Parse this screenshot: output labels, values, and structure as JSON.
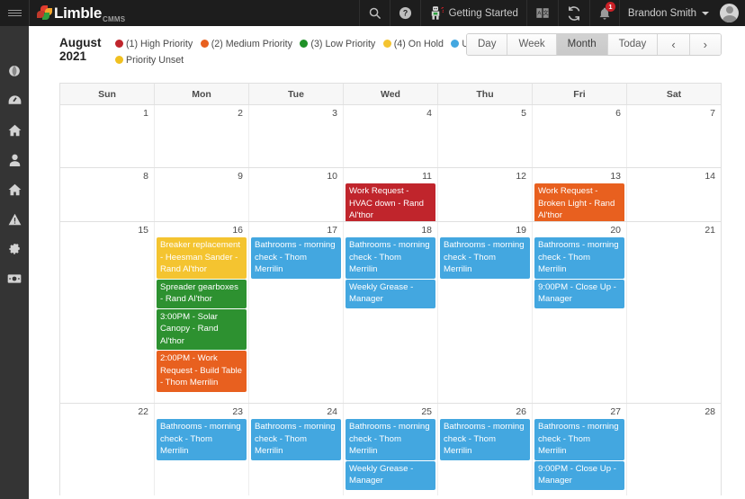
{
  "topbar": {
    "hamburger": "menu-icon",
    "logo_text": "Limble",
    "logo_sub": "CMMS",
    "getting_started": "Getting Started",
    "notification_count": "1",
    "user_name": "Brandon Smith"
  },
  "sidebar": {
    "items": [
      {
        "icon": "globe-icon",
        "name": "sidebar-item-globe"
      },
      {
        "icon": "dashboard-icon",
        "name": "sidebar-item-dashboard"
      },
      {
        "icon": "home-icon",
        "name": "sidebar-item-home"
      },
      {
        "icon": "user-icon",
        "name": "sidebar-item-user"
      },
      {
        "icon": "assets-icon",
        "name": "sidebar-item-assets"
      },
      {
        "icon": "warning-icon",
        "name": "sidebar-item-warning"
      },
      {
        "icon": "gear-icon",
        "name": "sidebar-item-settings"
      },
      {
        "icon": "money-icon",
        "name": "sidebar-item-billing"
      }
    ]
  },
  "calendar": {
    "month": "August",
    "year": "2021",
    "legend": [
      {
        "label": "(1) High Priority",
        "color": "#c0252c"
      },
      {
        "label": "(2) Medium Priority",
        "color": "#e8601f"
      },
      {
        "label": "(3) Low Priority",
        "color": "#1f9127"
      },
      {
        "label": "(4) On Hold",
        "color": "#f4c430"
      },
      {
        "label": "Upcoming",
        "color": "#43a7e0"
      },
      {
        "label": "Priority Unset",
        "color": "#f0c020"
      }
    ],
    "views": [
      {
        "label": "Day",
        "active": false
      },
      {
        "label": "Week",
        "active": false
      },
      {
        "label": "Month",
        "active": true
      },
      {
        "label": "Today",
        "active": false
      },
      {
        "label": "‹",
        "active": false
      },
      {
        "label": "›",
        "active": false
      }
    ],
    "day_headers": [
      "Sun",
      "Mon",
      "Tue",
      "Wed",
      "Thu",
      "Fri",
      "Sat"
    ],
    "weeks": [
      {
        "row": "wk-r1",
        "days": [
          {
            "num": "1",
            "events": []
          },
          {
            "num": "2",
            "events": []
          },
          {
            "num": "3",
            "events": []
          },
          {
            "num": "4",
            "events": []
          },
          {
            "num": "5",
            "events": []
          },
          {
            "num": "6",
            "events": []
          },
          {
            "num": "7",
            "events": []
          }
        ]
      },
      {
        "row": "wk-r2",
        "days": [
          {
            "num": "8",
            "events": []
          },
          {
            "num": "9",
            "events": []
          },
          {
            "num": "10",
            "events": []
          },
          {
            "num": "11",
            "events": [
              {
                "title": "Work Request - HVAC down - Rand Al'thor",
                "color": "#c0252c"
              }
            ]
          },
          {
            "num": "12",
            "events": []
          },
          {
            "num": "13",
            "events": [
              {
                "title": "Work Request - Broken Light - Rand Al'thor",
                "color": "#e8601f"
              }
            ]
          },
          {
            "num": "14",
            "events": []
          }
        ]
      },
      {
        "row": "wk-r3",
        "days": [
          {
            "num": "15",
            "events": []
          },
          {
            "num": "16",
            "events": [
              {
                "title": "Breaker replacement - Heesman Sander - Rand Al'thor",
                "color": "#f4c430"
              },
              {
                "title": "Spreader gearboxes - Rand Al'thor",
                "color": "#2d9130"
              },
              {
                "title": "3:00PM - Solar Canopy - Rand Al'thor",
                "color": "#2d9130"
              },
              {
                "title": "2:00PM - Work Request - Build Table - Thom Merrilin",
                "color": "#e8601f"
              }
            ]
          },
          {
            "num": "17",
            "events": [
              {
                "title": "Bathrooms - morning check - Thom Merrilin",
                "color": "#43a7e0"
              }
            ]
          },
          {
            "num": "18",
            "events": [
              {
                "title": "Bathrooms - morning check - Thom Merrilin",
                "color": "#43a7e0"
              },
              {
                "title": "Weekly Grease - Manager",
                "color": "#43a7e0"
              }
            ]
          },
          {
            "num": "19",
            "events": [
              {
                "title": "Bathrooms - morning check - Thom Merrilin",
                "color": "#43a7e0"
              }
            ]
          },
          {
            "num": "20",
            "events": [
              {
                "title": "Bathrooms - morning check - Thom Merrilin",
                "color": "#43a7e0"
              },
              {
                "title": "9:00PM - Close Up - Manager",
                "color": "#43a7e0"
              }
            ]
          },
          {
            "num": "21",
            "events": []
          }
        ]
      },
      {
        "row": "wk-r4",
        "days": [
          {
            "num": "22",
            "events": []
          },
          {
            "num": "23",
            "events": [
              {
                "title": "Bathrooms - morning check - Thom Merrilin",
                "color": "#43a7e0"
              }
            ]
          },
          {
            "num": "24",
            "events": [
              {
                "title": "Bathrooms - morning check - Thom Merrilin",
                "color": "#43a7e0"
              }
            ]
          },
          {
            "num": "25",
            "events": [
              {
                "title": "Bathrooms - morning check - Thom Merrilin",
                "color": "#43a7e0"
              },
              {
                "title": "Weekly Grease - Manager",
                "color": "#43a7e0"
              }
            ]
          },
          {
            "num": "26",
            "events": [
              {
                "title": "Bathrooms - morning check - Thom Merrilin",
                "color": "#43a7e0"
              }
            ]
          },
          {
            "num": "27",
            "events": [
              {
                "title": "Bathrooms - morning check - Thom Merrilin",
                "color": "#43a7e0"
              },
              {
                "title": "9:00PM - Close Up - Manager",
                "color": "#43a7e0"
              }
            ]
          },
          {
            "num": "28",
            "events": []
          }
        ]
      }
    ]
  }
}
